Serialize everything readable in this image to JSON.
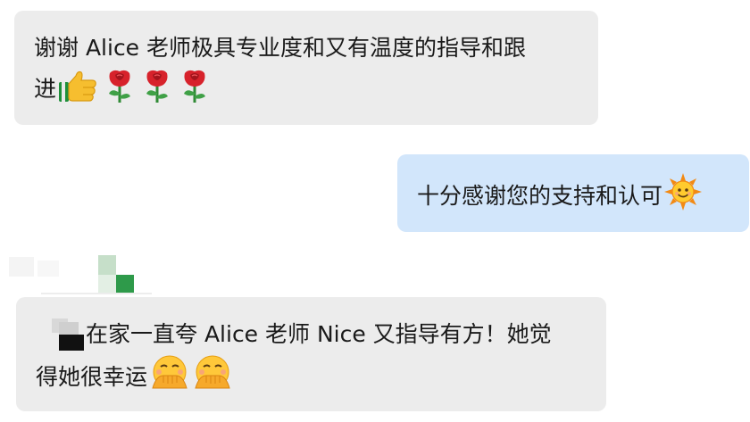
{
  "messages": [
    {
      "direction": "incoming",
      "lines": [
        "谢谢 Alice 老师极具专业度和又有温度的指导和跟",
        "进"
      ],
      "emojis": [
        "thumbs-up-icon",
        "rose-icon",
        "rose-icon",
        "rose-icon"
      ]
    },
    {
      "direction": "outgoing",
      "lines": [
        "十分感谢您的支持和认可"
      ],
      "emojis": [
        "sun-with-face-icon"
      ]
    },
    {
      "direction": "incoming",
      "sender_redacted": true,
      "lines": [
        "在家一直夸 Alice 老师 Nice 又指导有方！她觉",
        "得她很幸运"
      ],
      "emojis": [
        "face-with-hand-over-mouth-icon",
        "face-with-hand-over-mouth-icon"
      ]
    }
  ],
  "colors": {
    "incoming_bubble": "#ececec",
    "outgoing_bubble": "#d2e6fb",
    "text": "#1a1a1a",
    "mosaic_green": "#2e9a4a"
  }
}
